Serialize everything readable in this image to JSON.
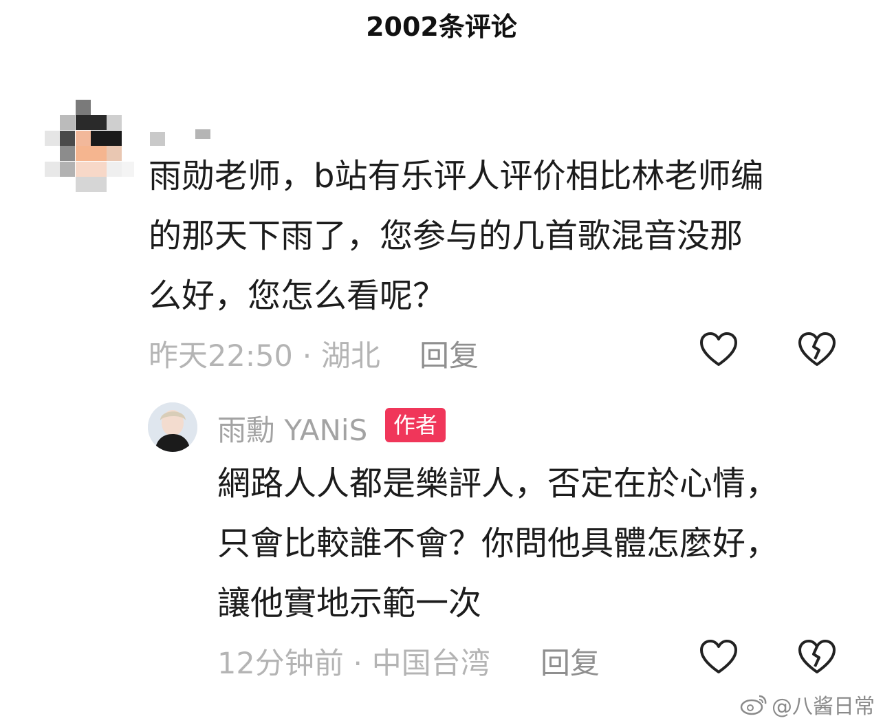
{
  "header": {
    "title": "2002条评论"
  },
  "comment": {
    "text_lines": [
      "雨勋老师，b站有乐评人评价相比林老师编",
      "的那天下雨了，您参与的几首歌混音没那",
      "么好，您怎么看呢？"
    ],
    "time_location": "昨天22:50 · 湖北",
    "reply_label": "回复"
  },
  "reply": {
    "author_name": "雨勳 YANiS",
    "author_badge": "作者",
    "text_lines": [
      "網路人人都是樂評人，否定在於心情，",
      "只會比較誰不會？你問他具體怎麼好，",
      "讓他實地示範一次"
    ],
    "time_location": "12分钟前 · 中国台湾",
    "reply_label": "回复"
  },
  "watermark": {
    "text": "@八酱日常"
  },
  "icons": {
    "like": "heart-outline-icon",
    "dislike": "broken-heart-icon",
    "weibo": "weibo-logo-icon"
  },
  "colors": {
    "badge": "#f0365a",
    "meta_text": "#b4b4b4",
    "body_text": "#1c1c1c"
  }
}
